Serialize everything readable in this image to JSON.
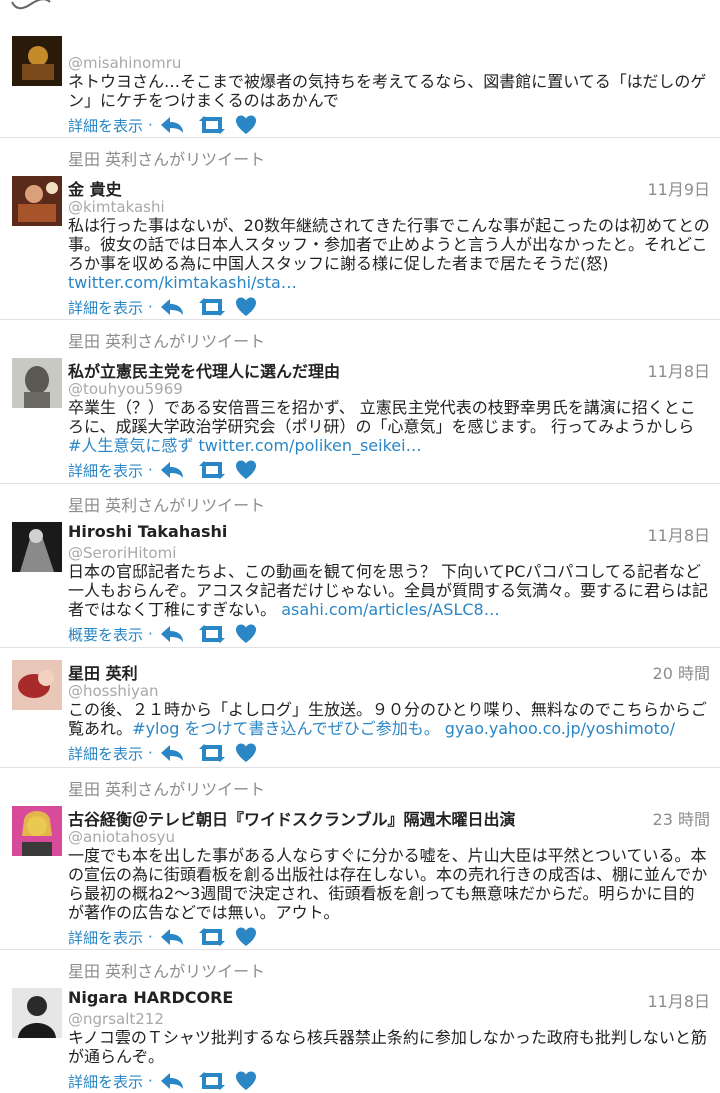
{
  "ui": {
    "link_color": "#2a86c4",
    "icon_names": [
      "reply-icon",
      "retweet-icon",
      "like-icon"
    ]
  },
  "tweets": [
    {
      "retweet_label": "",
      "name": "",
      "handle": "@misahinomru",
      "time": "",
      "text": "ネトウヨさん…そこまで被爆者の気持ちを考えてるなら、図書館に置いてる「はだしのゲン」にケチをつけまくるのはあかんで",
      "link": "",
      "action_label": "詳細を表示"
    },
    {
      "retweet_label": "星田 英利さんがリツイート",
      "name": "金 貴史",
      "handle": "@kimtakashi",
      "time": "11月9日",
      "text": "私は行った事はないが、20数年継続されてきた行事でこんな事が起こったのは初めてとの事。彼女の話では日本人スタッフ・参加者で止めようと言う人が出なかったと。それどころか事を収める為に中国人スタッフに謝る様に促した者まで居たそうだ(怒) ",
      "link": "twitter.com/kimtakashi/sta…",
      "action_label": "詳細を表示"
    },
    {
      "retweet_label": "星田 英利さんがリツイート",
      "name": "私が立憲民主党を代理人に選んだ理由",
      "handle": "@touhyou5969",
      "time": "11月8日",
      "text": "卒業生（？）である安倍晋三を招かず、 立憲民主党代表の枝野幸男氏を講演に招くところに、成蹊大学政治学研究会（ポリ研）の「心意気」を感じます。 行ってみようかしら ",
      "link": "#人生意気に感ず twitter.com/poliken_seikei…",
      "action_label": "詳細を表示"
    },
    {
      "retweet_label": "星田 英利さんがリツイート",
      "name": "Hiroshi Takahashi",
      "handle": "@SeroriHitomi",
      "time": "11月8日",
      "text": "日本の官邸記者たちよ、この動画を観て何を思う？ 下向いてPCパコパコしてる記者など一人もおらんぞ。アコスタ記者だけじゃない。全員が質問する気満々。要するに君らは記者ではなく丁稚にすぎない。 ",
      "link": "asahi.com/articles/ASLC8…",
      "action_label": "概要を表示"
    },
    {
      "retweet_label": "",
      "name": "星田 英利",
      "handle": "@hosshiyan",
      "time": "20 時間",
      "text": "この後、２１時から「よしログ」生放送。９０分のひとり喋り、無料なのでこちらからご覧あれ。",
      "link": "#ylog をつけて書き込んでぜひご参加も。 gyao.yahoo.co.jp/yoshimoto/",
      "action_label": "詳細を表示"
    },
    {
      "retweet_label": "星田 英利さんがリツイート",
      "name": "古谷経衡＠テレビ朝日『ワイドスクランブル』隔週木曜日出演",
      "handle": "@aniotahosyu",
      "time": "23 時間",
      "text": "一度でも本を出した事がある人ならすぐに分かる嘘を、片山大臣は平然とついている。本の宣伝の為に街頭看板を創る出版社は存在しない。本の売れ行きの成否は、棚に並んでから最初の概ね2～3週間で決定され、街頭看板を創っても無意味だからだ。明らかに目的が著作の広告などでは無い。アウト。",
      "link": "",
      "action_label": "詳細を表示"
    },
    {
      "retweet_label": "星田 英利さんがリツイート",
      "name": "Nigara HARDCORE",
      "handle": "@ngrsalt212",
      "time": "11月8日",
      "text": "キノコ雲のＴシャツ批判するなら核兵器禁止条約に参加しなかった政府も批判しないと筋が通らんぞ。",
      "link": "",
      "action_label": "詳細を表示"
    }
  ]
}
